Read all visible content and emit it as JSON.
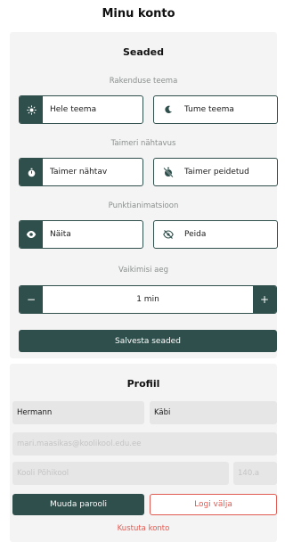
{
  "page": {
    "title": "Minu konto"
  },
  "settings": {
    "title": "Seaded",
    "theme": {
      "label": "Rakenduse teema",
      "light": "Hele teema",
      "dark": "Tume teema",
      "selected": "light"
    },
    "timer": {
      "label": "Taimeri nähtavus",
      "visible": "Taimer nähtav",
      "hidden": "Taimer peidetud",
      "selected": "visible"
    },
    "punctuation": {
      "label": "Punktianimatsioon",
      "show": "Näita",
      "hide": "Peida",
      "selected": "show"
    },
    "default_time": {
      "label": "Vaikimisi aeg",
      "minus": "−",
      "value": "1 min",
      "plus": "+"
    },
    "save_label": "Salvesta seaded"
  },
  "profile": {
    "title": "Profiil",
    "first_name": "Hermann",
    "last_name": "Käbi",
    "email": "mari.maasikas@koolikool.edu.ee",
    "school": "Kooli Põhikool",
    "class": "140.a",
    "change_password_label": "Muuda parooli",
    "logout_label": "Logi välja",
    "delete_label": "Kustuta konto"
  },
  "colors": {
    "accent": "#2f4f4c",
    "danger": "#e05a52",
    "card": "#f4f4f4"
  },
  "icons": {
    "theme_light": "sun-icon",
    "theme_dark": "moon-icon",
    "timer_visible": "stopwatch-icon",
    "timer_hidden": "stopwatch-off-icon",
    "punct_show": "eye-icon",
    "punct_hide": "eye-off-icon"
  }
}
